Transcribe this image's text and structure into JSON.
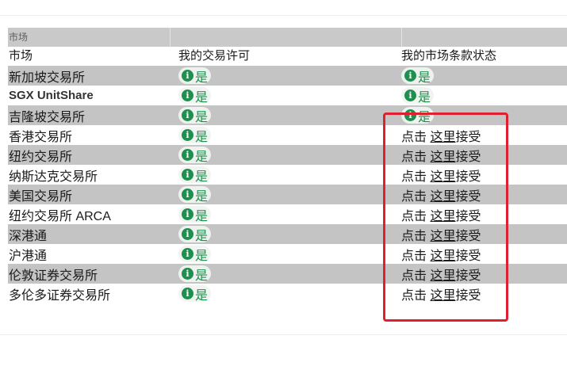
{
  "table": {
    "group_header": "市场",
    "columns": [
      "市场",
      "我的交易许可",
      "我的市场条款状态"
    ],
    "rows": [
      {
        "market": "新加坡交易所",
        "permission": "是",
        "status_type": "badge",
        "status": "是"
      },
      {
        "market": "SGX UnitShare",
        "permission": "是",
        "status_type": "badge",
        "status": "是"
      },
      {
        "market": "吉隆坡交易所",
        "permission": "是",
        "status_type": "badge",
        "status": "是"
      },
      {
        "market": "香港交易所",
        "permission": "是",
        "status_type": "accept",
        "status_prefix": "点击",
        "status_link": "这里",
        "status_suffix": "接受"
      },
      {
        "market": "纽约交易所",
        "permission": "是",
        "status_type": "accept",
        "status_prefix": "点击",
        "status_link": "这里",
        "status_suffix": "接受"
      },
      {
        "market": "纳斯达克交易所",
        "permission": "是",
        "status_type": "accept",
        "status_prefix": "点击",
        "status_link": "这里",
        "status_suffix": "接受"
      },
      {
        "market": "美国交易所",
        "permission": "是",
        "status_type": "accept",
        "status_prefix": "点击",
        "status_link": "这里",
        "status_suffix": "接受"
      },
      {
        "market": "纽约交易所 ARCA",
        "permission": "是",
        "status_type": "accept",
        "status_prefix": "点击",
        "status_link": "这里",
        "status_suffix": "接受"
      },
      {
        "market": "深港通",
        "permission": "是",
        "status_type": "accept",
        "status_prefix": "点击",
        "status_link": "这里",
        "status_suffix": "接受"
      },
      {
        "market": "沪港通",
        "permission": "是",
        "status_type": "accept",
        "status_prefix": "点击",
        "status_link": "这里",
        "status_suffix": "接受"
      },
      {
        "market": "伦敦证券交易所",
        "permission": "是",
        "status_type": "accept",
        "status_prefix": "点击",
        "status_link": "这里",
        "status_suffix": "接受"
      },
      {
        "market": "多伦多证券交易所",
        "permission": "是",
        "status_type": "accept",
        "status_prefix": "点击",
        "status_link": "这里",
        "status_suffix": "接受"
      }
    ]
  },
  "icons": {
    "permission_badge": "info-circle-icon"
  },
  "colors": {
    "badge_green": "#1e8f4e",
    "shaded_row": "#c4c4c4",
    "highlight_box": "#e0202e"
  }
}
